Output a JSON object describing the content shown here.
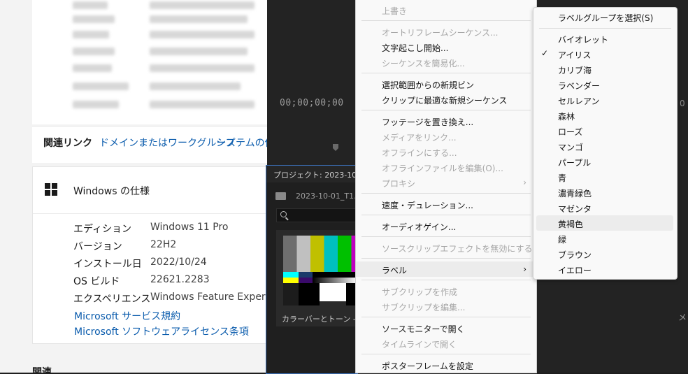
{
  "settings": {
    "related_links_label": "関連リンク",
    "related_links": [
      "ドメインまたはワークグループ",
      "システムの保"
    ],
    "spec_title": "Windows の仕様",
    "specs": [
      {
        "key": "エディション",
        "value": "Windows 11 Pro"
      },
      {
        "key": "バージョン",
        "value": "22H2"
      },
      {
        "key": "インストール日",
        "value": "2022/10/24"
      },
      {
        "key": "OS ビルド",
        "value": "22621.2283"
      },
      {
        "key": "エクスペリエンス",
        "value": "Windows Feature Experience"
      }
    ],
    "links": [
      "Microsoft サービス規約",
      "Microsoft ソフトウェアライセンス条項"
    ],
    "bottom_heading": "関連"
  },
  "premiere": {
    "timecode": "00;00;00;00",
    "project_title": "プロジェクト: 2023-10-",
    "project_path": "2023-10-01_T1.p",
    "thumbnail_label": "カラーバーとトーン -",
    "right_edge_text": "メ",
    "right_edge_mark": "0"
  },
  "context_menu": {
    "items": [
      {
        "label": "上書き",
        "disabled": true
      },
      {
        "sep": true
      },
      {
        "label": "オートリフレームシーケンス...",
        "disabled": true
      },
      {
        "label": "文字起こし開始...",
        "disabled": false
      },
      {
        "label": "シーケンスを簡易化...",
        "disabled": true
      },
      {
        "sep": true
      },
      {
        "label": "選択範囲からの新規ビン",
        "disabled": false
      },
      {
        "label": "クリップに最適な新規シーケンス",
        "disabled": false
      },
      {
        "sep": true
      },
      {
        "label": "フッテージを置き換え...",
        "disabled": false
      },
      {
        "label": "メディアをリンク...",
        "disabled": true
      },
      {
        "label": "オフラインにする...",
        "disabled": true
      },
      {
        "label": "オフラインファイルを編集(O)...",
        "disabled": true
      },
      {
        "label": "プロキシ",
        "disabled": true,
        "submenu": true
      },
      {
        "sep": true
      },
      {
        "label": "速度・デュレーション...",
        "disabled": false
      },
      {
        "sep": true
      },
      {
        "label": "オーディオゲイン...",
        "disabled": false
      },
      {
        "sep": true
      },
      {
        "label": "ソースクリップエフェクトを無効にする",
        "disabled": true
      },
      {
        "sep": true
      },
      {
        "label": "ラベル",
        "disabled": false,
        "submenu": true,
        "highlighted": true
      },
      {
        "sep": true
      },
      {
        "label": "サブクリップを作成",
        "disabled": true
      },
      {
        "label": "サブクリップを編集...",
        "disabled": true
      },
      {
        "sep": true
      },
      {
        "label": "ソースモニターで開く",
        "disabled": false
      },
      {
        "label": "タイムラインで開く",
        "disabled": true
      },
      {
        "sep": true
      },
      {
        "label": "ポスターフレームを設定",
        "disabled": false
      }
    ]
  },
  "label_submenu": {
    "select_group": "ラベルグループを選択(S)",
    "checked_label": "アイリス",
    "highlighted_label": "黄褐色",
    "labels": [
      "バイオレット",
      "アイリス",
      "カリブ海",
      "ラベンダー",
      "セルレアン",
      "森林",
      "ローズ",
      "マンゴ",
      "パープル",
      "青",
      "濃青緑色",
      "マゼンタ",
      "黄褐色",
      "緑",
      "ブラウン",
      "イエロー"
    ]
  },
  "colors": {
    "link": "#0b5cad",
    "menu_bg": "#f9f9f9",
    "disabled_text": "#a6a6a6",
    "project_border": "#3b6fb6",
    "color_bars": [
      "#6e6e6e",
      "#c0c0c0",
      "#c0c000",
      "#00c0c0",
      "#00c000",
      "#c000c0"
    ]
  }
}
